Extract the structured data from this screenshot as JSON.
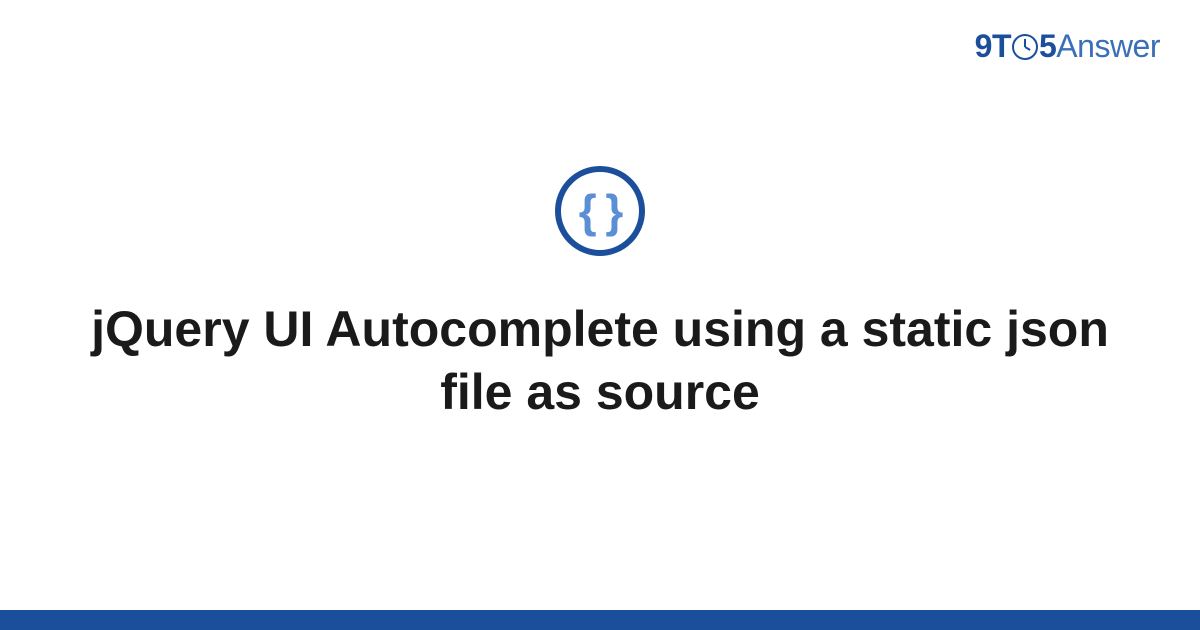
{
  "logo": {
    "part1": "9",
    "part2": "T",
    "part3": "5",
    "part4": "Answer"
  },
  "icon": {
    "name": "code-braces",
    "glyph": "{ }"
  },
  "title": "jQuery UI Autocomplete using a static json file as source"
}
